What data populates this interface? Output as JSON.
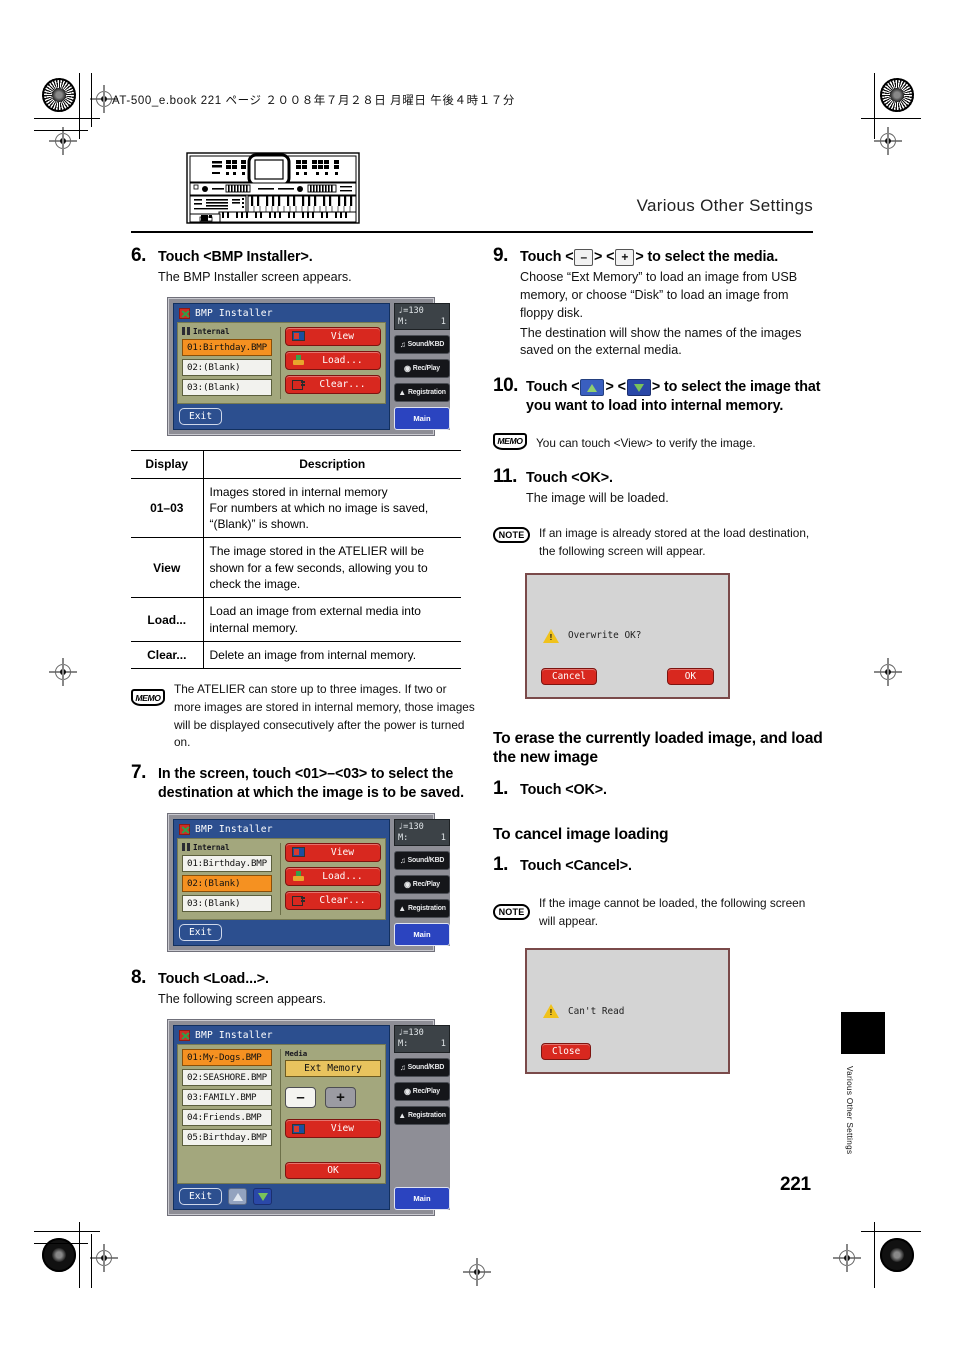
{
  "print": {
    "slug": "AT-500_e.book  221 ページ  ２００８年７月２８日   月曜日   午後４時１７分"
  },
  "header": {
    "title": "Various Other Settings"
  },
  "page": {
    "number": "221",
    "side_tab_label": "Various Other Settings"
  },
  "steps": {
    "s6": {
      "num": "6.",
      "title": "Touch <BMP Installer>.",
      "body": "The BMP Installer screen appears."
    },
    "s7": {
      "num": "7.",
      "title": "In the screen, touch <01>–<03> to select the destination at which the image is to be saved."
    },
    "s8": {
      "num": "8.",
      "title": "Touch <Load...>.",
      "body": "The following screen appears."
    },
    "s9": {
      "num": "9.",
      "title_a": "Touch <",
      "title_b": "> <",
      "title_c": "> to select the media.",
      "minus": "–",
      "plus": "+",
      "body1": "Choose “Ext Memory” to load an image from USB memory, or choose “Disk” to load an image from floppy disk.",
      "body2": "The destination will show the names of the images saved on the external media."
    },
    "s10": {
      "num": "10.",
      "title_a": "Touch <",
      "title_b": "> <",
      "title_c": "> to select the image that you want to load into internal memory."
    },
    "s11": {
      "num": "11.",
      "title": "Touch <OK>.",
      "body": "The image will be loaded."
    }
  },
  "memos": {
    "m1": "The ATELIER can store up to three images. If two or more images are stored in internal memory, those images will be displayed consecutively after the power is turned on.",
    "m2": "You can touch <View> to verify the image.",
    "badge": "MEMO"
  },
  "notes": {
    "n1": "If an image is already stored at the load destination, the following screen will appear.",
    "n2": "If the image cannot be loaded, the following screen will appear.",
    "badge": "NOTE"
  },
  "table": {
    "headers": [
      "Display",
      "Description"
    ],
    "rows": [
      {
        "display": "01–03",
        "description": "Images stored in internal memory\nFor numbers at which no image is saved, “(Blank)” is shown."
      },
      {
        "display": "View",
        "description": "The image stored in the ATELIER will be shown for a few seconds, allowing you to check the image."
      },
      {
        "display": "Load...",
        "description": "Load an image from external media into internal memory."
      },
      {
        "display": "Clear...",
        "description": "Delete an image from internal memory."
      }
    ]
  },
  "subheads": {
    "erase": "To erase the currently loaded image, and load the new image",
    "cancel": "To cancel image loading"
  },
  "substeps": {
    "erase_num": "1.",
    "erase_title": "Touch <OK>.",
    "cancel_num": "1.",
    "cancel_title": "Touch <Cancel>."
  },
  "lcd": {
    "window_title": "BMP Installer",
    "group_label": "Internal",
    "tempo_note": "♩=130",
    "measure_key": "M:",
    "measure_val": "1",
    "side_buttons": [
      "Sound/KBD",
      "Rec/Play",
      "Registration"
    ],
    "main_button": "Main",
    "exit_button": "Exit",
    "buttons": {
      "view": "View",
      "load": "Load...",
      "clear": "Clear...",
      "ok": "OK"
    },
    "screen1": {
      "items": [
        "01:Birthday.BMP",
        "02:(Blank)",
        "03:(Blank)"
      ],
      "selected_index": 0
    },
    "screen2": {
      "items": [
        "01:Birthday.BMP",
        "02:(Blank)",
        "03:(Blank)"
      ],
      "selected_index": 1
    },
    "screen3": {
      "items": [
        "01:My-Dogs.BMP",
        "02:SEASHORE.BMP",
        "03:FAMILY.BMP",
        "04:Friends.BMP",
        "05:Birthday.BMP"
      ],
      "selected_index": 0,
      "media_label": "Media",
      "media_value": "Ext Memory",
      "minus": "–",
      "plus": "+"
    }
  },
  "dialogs": {
    "overwrite": {
      "message": "Overwrite OK?",
      "cancel": "Cancel",
      "ok": "OK"
    },
    "cantread": {
      "message": "Can't Read",
      "close": "Close"
    }
  },
  "colors": {
    "selection_orange": "#f59121",
    "lcd_blue": "#2c4f8f",
    "panel_olive": "#a3a77d",
    "button_red": "#d8281f",
    "main_blue": "#2b44c0",
    "media_yellow": "#e8c35e"
  }
}
